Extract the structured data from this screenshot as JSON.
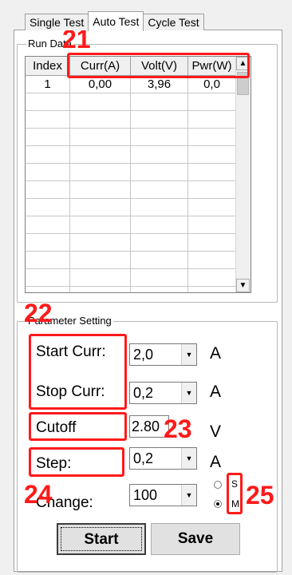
{
  "tabs": [
    "Single Test",
    "Auto Test",
    "Cycle Test"
  ],
  "active_tab": "Auto Test",
  "run_data": {
    "title": "Run Data",
    "columns": [
      "Index",
      "Curr(A)",
      "Volt(V)",
      "Pwr(W)"
    ],
    "rows": [
      [
        "1",
        "0,00",
        "3,96",
        "0,0"
      ]
    ]
  },
  "params": {
    "title": "Parameter Setting",
    "start_curr": {
      "label": "Start Curr:",
      "value": "2,0",
      "unit": "A"
    },
    "stop_curr": {
      "label": "Stop Curr:",
      "value": "0,2",
      "unit": "A"
    },
    "cutoff": {
      "label": "Cutoff",
      "value": "2.80",
      "unit": "V"
    },
    "step": {
      "label": "Step:",
      "value": "0,2",
      "unit": "A"
    },
    "change": {
      "label": "Change:",
      "value": "100"
    },
    "mode_options": [
      "S",
      "M"
    ],
    "mode_selected": "M"
  },
  "buttons": {
    "start": "Start",
    "save": "Save"
  },
  "annotations": [
    "21",
    "22",
    "23",
    "24",
    "25"
  ],
  "colors": {
    "annotation": "#ff1a1a",
    "panel": "#f0f0f0"
  }
}
